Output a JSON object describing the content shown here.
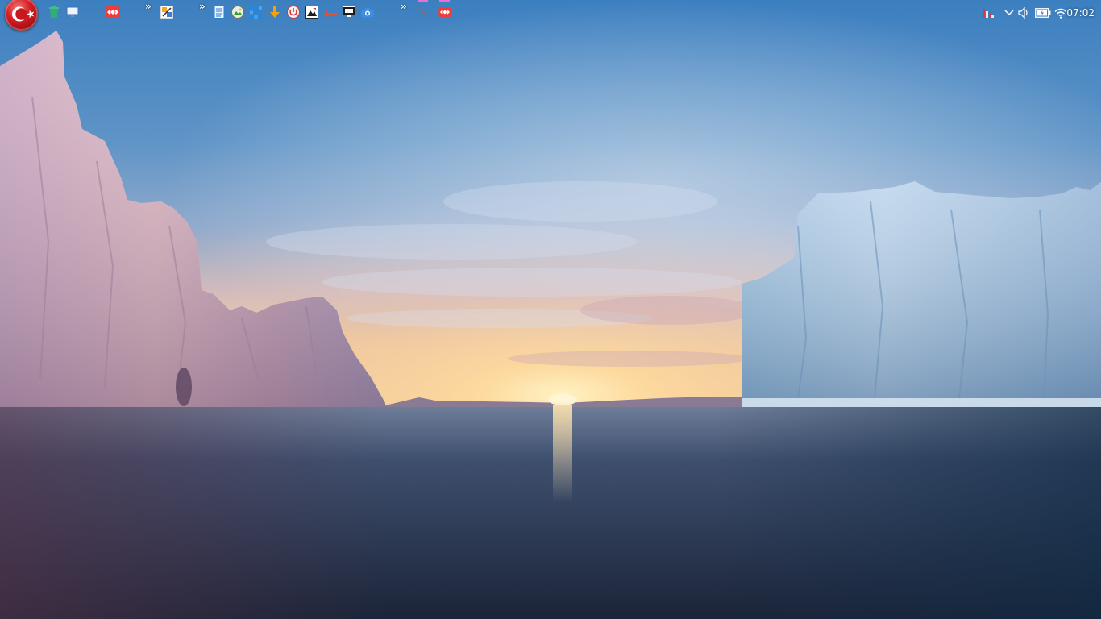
{
  "desktop": {
    "wallpaper_description_icon": "landscape-icon"
  },
  "start_button": {
    "icon": "turkish-flag-orb-icon"
  },
  "launchers": [
    {
      "icon": "recycle-bin-icon"
    },
    {
      "icon": "show-desktop-icon"
    },
    {
      "icon": "anydesk-icon"
    },
    {
      "icon": "file-manager-icon"
    },
    {
      "icon": "notepad-icon"
    },
    {
      "icon": "photo-viewer-icon"
    },
    {
      "icon": "app-grid-icon"
    },
    {
      "icon": "download-manager-icon"
    },
    {
      "icon": "power-icon"
    },
    {
      "icon": "image-editor-icon"
    },
    {
      "icon": "switch-icon"
    },
    {
      "icon": "display-icon"
    },
    {
      "icon": "camera-icon"
    },
    {
      "icon": "pen-tool-icon"
    },
    {
      "icon": "anydesk-running-icon"
    }
  ],
  "overflow_chevron": "»",
  "tray": {
    "icons": [
      "task-manager-icon",
      "chevron-down-icon",
      "volume-icon",
      "battery-charging-icon",
      "wifi-icon"
    ],
    "clock_time": "07:02"
  },
  "colors": {
    "accent_red": "#d41f25",
    "anydesk_red": "#ef3b3b",
    "running_indicator": "#ea6fce"
  }
}
